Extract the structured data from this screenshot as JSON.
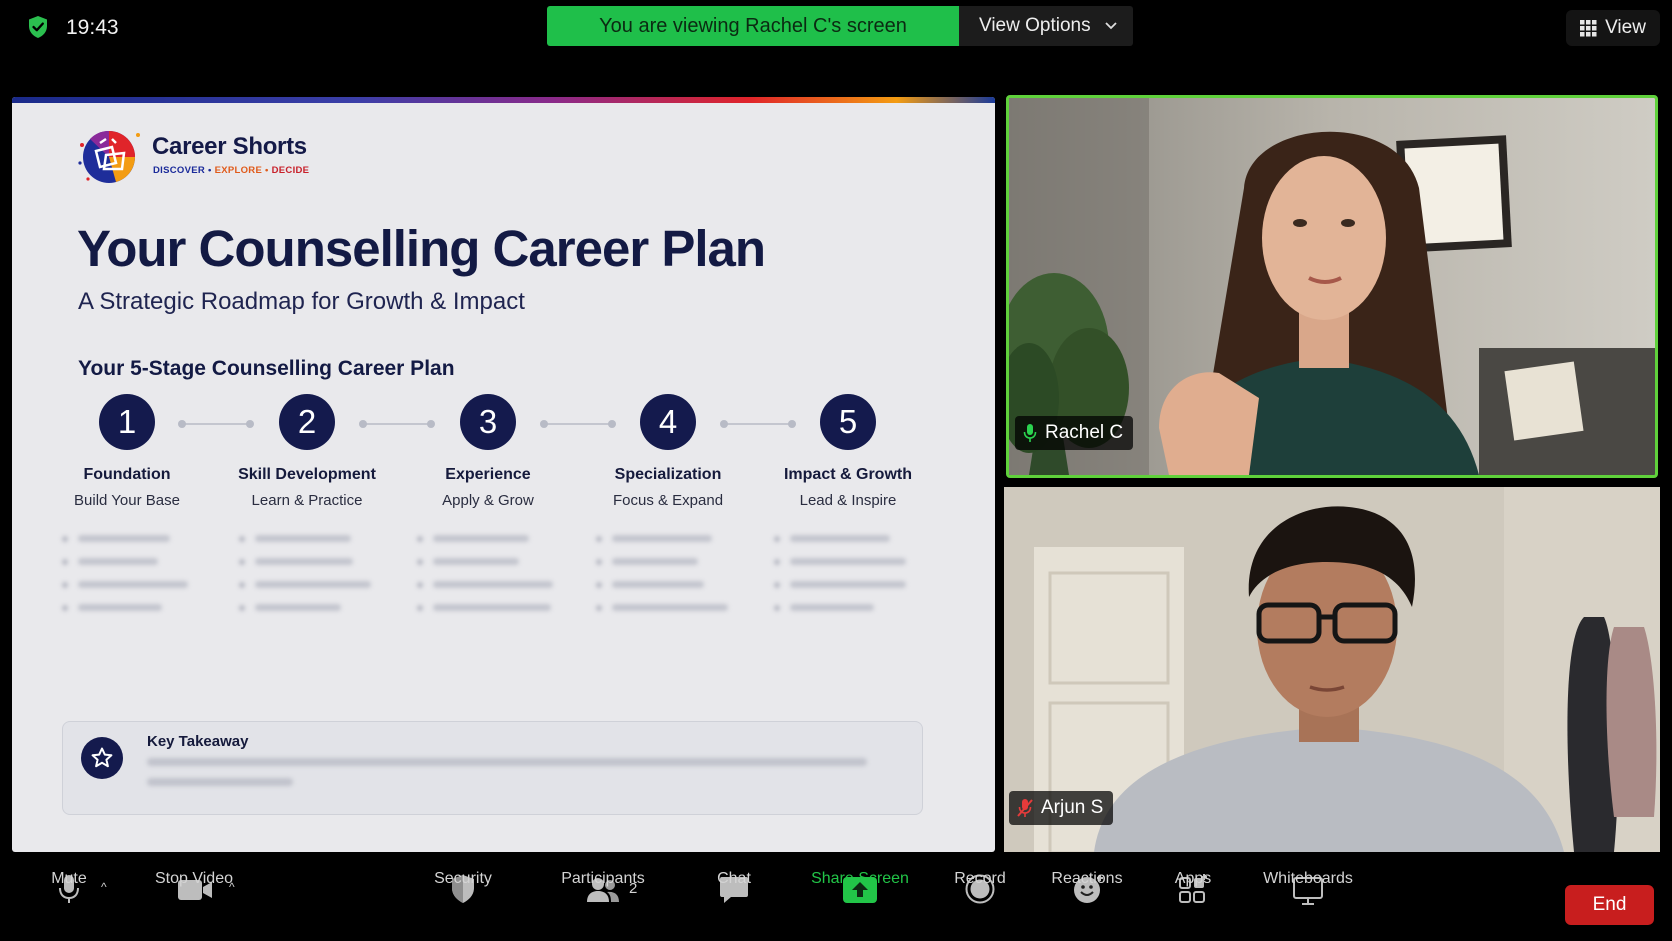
{
  "status_bar": {
    "time": "19:43",
    "banner": "You are viewing Rachel C's screen",
    "view_options": "View Options",
    "view_button": "View"
  },
  "slide": {
    "brand": {
      "name": "Career Shorts",
      "tagline": [
        {
          "text": "DISCOVER",
          "color": "#1a2a9a"
        },
        {
          "text": "•",
          "color": "#1a2a9a"
        },
        {
          "text": "EXPLORE",
          "color": "#e05a1a"
        },
        {
          "text": "•",
          "color": "#e05a1a"
        },
        {
          "text": "DECIDE",
          "color": "#c8202a"
        }
      ]
    },
    "title": "Your Counselling Career Plan",
    "subtitle": "A Strategic Roadmap for Growth & Impact",
    "stages_heading": "Your 5-Stage Counselling Career Plan",
    "stages": [
      {
        "number": "1",
        "name": "Foundation",
        "desc": "Build Your Base"
      },
      {
        "number": "2",
        "name": "Skill Development",
        "desc": "Learn & Practice"
      },
      {
        "number": "3",
        "name": "Experience",
        "desc": "Apply & Grow"
      },
      {
        "number": "4",
        "name": "Specialization",
        "desc": "Focus & Expand"
      },
      {
        "number": "5",
        "name": "Impact & Growth",
        "desc": "Lead & Inspire"
      }
    ],
    "takeaway_title": "Key Takeaway"
  },
  "participants": {
    "presenter": {
      "name": "Rachel C",
      "mic": "on"
    },
    "viewer": {
      "name": "Arjun S",
      "mic": "muted"
    }
  },
  "toolbar": {
    "mute": "Mute",
    "stop_video": "Stop Video",
    "security": "Security",
    "participants": "Participants",
    "participants_count": "2",
    "chat": "Chat",
    "share_screen": "Share Screen",
    "record": "Record",
    "reactions": "Reactions",
    "apps": "Apps",
    "whiteboards": "Whiteboards",
    "end": "End"
  },
  "colors": {
    "accent_green": "#1fbf4a",
    "share_green": "#22c548",
    "end_red": "#c81e1e",
    "slide_navy": "#141a4d"
  }
}
